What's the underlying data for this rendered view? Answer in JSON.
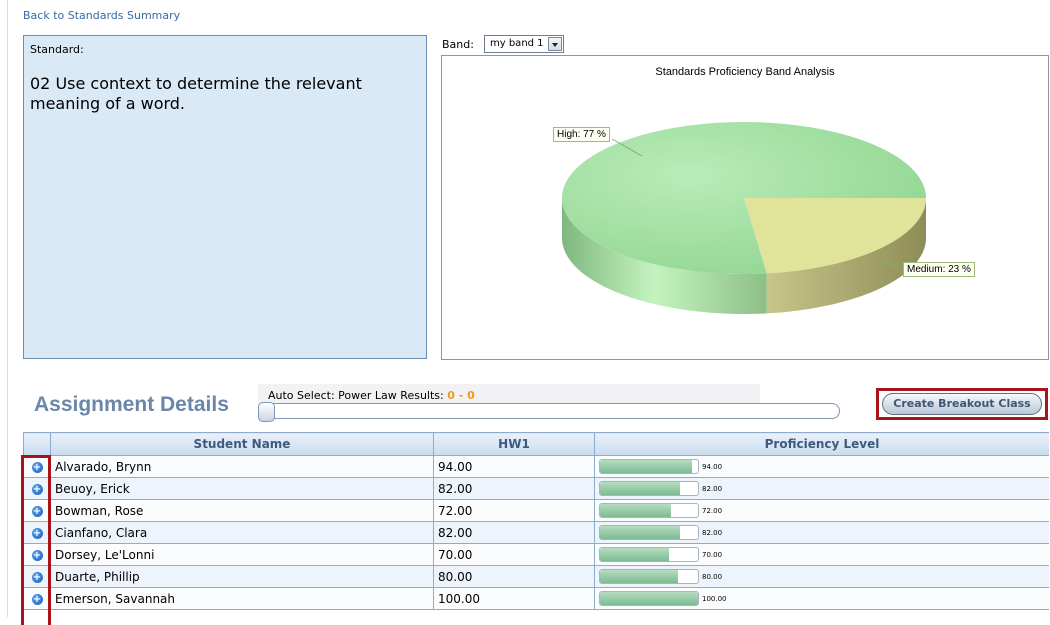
{
  "nav": {
    "back_link": "Back to Standards Summary"
  },
  "standard": {
    "label": "Standard:",
    "text": "02 Use context to determine the relevant meaning of a word."
  },
  "band": {
    "label": "Band:",
    "selected": "my band 1"
  },
  "chart_data": {
    "type": "pie",
    "title": "Standards Proficiency Band Analysis",
    "categories": [
      "High",
      "Medium"
    ],
    "values": [
      77,
      23
    ],
    "labels": [
      "High: 77 %",
      "Medium: 23 %"
    ],
    "colors": [
      "#a7e3a7",
      "#dfe49a"
    ],
    "style": "3d"
  },
  "assignment": {
    "title": "Assignment Details",
    "auto_select_label": "Auto Select: Power Law Results:",
    "auto_select_value": "0 - 0",
    "breakout_button": "Create Breakout Class"
  },
  "table": {
    "columns": [
      "Student Name",
      "HW1",
      "Proficiency Level"
    ],
    "rows": [
      {
        "name": "Alvarado, Brynn",
        "hw1": "94.00",
        "level": "94.00",
        "pct": 94
      },
      {
        "name": "Beuoy, Erick",
        "hw1": "82.00",
        "level": "82.00",
        "pct": 82
      },
      {
        "name": "Bowman, Rose",
        "hw1": "72.00",
        "level": "72.00",
        "pct": 72
      },
      {
        "name": "Cianfano,  Clara",
        "hw1": "82.00",
        "level": "82.00",
        "pct": 82
      },
      {
        "name": "Dorsey, Le'Lonni",
        "hw1": "70.00",
        "level": "70.00",
        "pct": 70
      },
      {
        "name": "Duarte, Phillip",
        "hw1": "80.00",
        "level": "80.00",
        "pct": 80
      },
      {
        "name": "Emerson, Savannah",
        "hw1": "100.00",
        "level": "100.00",
        "pct": 100
      }
    ]
  }
}
